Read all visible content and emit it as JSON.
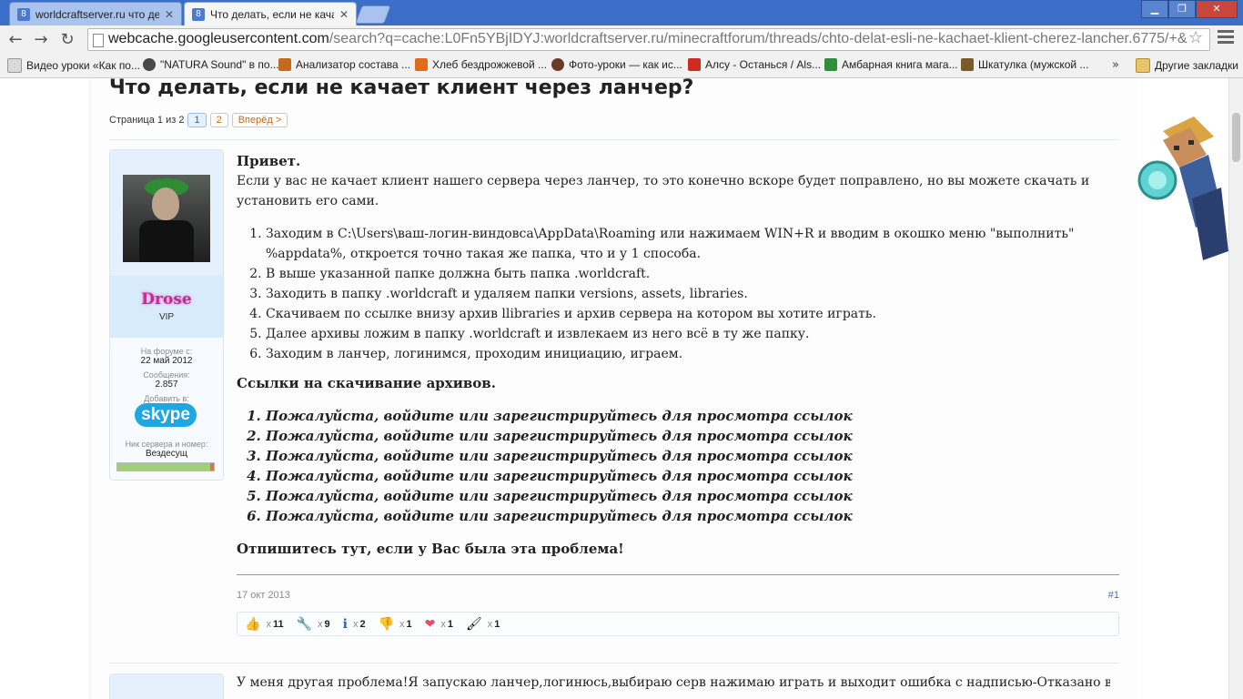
{
  "browser": {
    "tabs": [
      {
        "title": "worldcraftserver.ru что дел",
        "active": false
      },
      {
        "title": "Что делать, если не качае",
        "active": true
      }
    ],
    "window_buttons": {
      "minimize": "▁",
      "maximize": "❐",
      "close": "✕"
    },
    "nav": {
      "back": "←",
      "forward": "→",
      "reload": "↻"
    },
    "address": {
      "host": "webcache.googleusercontent.com",
      "rest": "/search?q=cache:L0Fn5YBjIDYJ:worldcraftserver.ru/minecraftforum/threads/chto-delat-esli-ne-kachaet-klient-cherez-lancher.6775/+&"
    },
    "bookmarks": [
      {
        "label": "Видео уроки «Как по...",
        "color": "#d9d9d9"
      },
      {
        "label": "\"NATURA Sound\" в по...",
        "color": "#4a4a4a"
      },
      {
        "label": "Анализатор состава ...",
        "color": "#c46b1b"
      },
      {
        "label": "Хлеб бездрожжевой ...",
        "color": "#e06a1e"
      },
      {
        "label": "Фото-уроки — как ис...",
        "color": "#6b3b2a"
      },
      {
        "label": "Алсу - Останься / Als...",
        "color": "#d12a21"
      },
      {
        "label": "Амбарная книга мага...",
        "color": "#2f8f3a"
      },
      {
        "label": "Шкатулка (мужской ...",
        "color": "#7a5a2b"
      }
    ],
    "bookmarks_more": "»",
    "other_bookmarks": "Другие закладки"
  },
  "thread": {
    "title": "Что делать, если не качает клиент через ланчер?",
    "page_label": "Страница 1 из 2",
    "pages": [
      "1",
      "2"
    ],
    "next": "Вперёд >"
  },
  "user": {
    "name": "Drose",
    "rank": "VIP",
    "joined_label": "На форуме с:",
    "joined": "22 май 2012",
    "posts_label": "Сообщения:",
    "posts": "2.857",
    "add_label": "Добавить в:",
    "skype": "skype",
    "server_label": "Ник сервера и номер:",
    "server": "Вездесущ"
  },
  "post": {
    "greeting": "Привет.",
    "intro": "Если у вас не качает клиент нашего сервера через ланчер, то это конечно вскоре будет поправлено, но вы можете скачать и установить его сами.",
    "steps": [
      "Заходим в C:\\Users\\ваш-логин-виндовса\\AppData\\Roaming или нажимаем WIN+R и вводим в окошко меню \"выполнить\" %appdata%, откроется точно такая же папка, что и у 1 способа.",
      "В выше указанной папке должна быть папка .worldcraft.",
      "Заходить в папку .worldcraft и удаляем папки versions, assets, libraries.",
      "Скачиваем по ссылке внизу архив llibraries и архив сервера на котором вы хотите играть.",
      "Далее архивы ложим в папку .worldcraft и извлекаем из него всё в ту же папку.",
      "Заходим в ланчер, логинимся, проходим инициацию, играем."
    ],
    "links_heading": "Ссылки на скачивание архивов.",
    "links": [
      "Пожалуйста, войдите или зарегистрируйтесь для просмотра ссылок",
      "Пожалуйста, войдите или зарегистрируйтесь для просмотра ссылок",
      "Пожалуйста, войдите или зарегистрируйтесь для просмотра ссылок",
      "Пожалуйста, войдите или зарегистрируйтесь для просмотра ссылок",
      "Пожалуйста, войдите или зарегистрируйтесь для просмотра ссылок",
      "Пожалуйста, войдите или зарегистрируйтесь для просмотра ссылок"
    ],
    "outro": "Отпишитесь тут, если у Вас была эта проблема!",
    "date": "17 окт 2013",
    "number": "#1",
    "ratings": [
      {
        "icon": "thumbs-up-icon",
        "glyph": "👍",
        "x": "x",
        "count": "11"
      },
      {
        "icon": "wrench-icon",
        "glyph": "🔧",
        "x": "x",
        "count": "9"
      },
      {
        "icon": "info-icon",
        "glyph": "ℹ",
        "x": "x",
        "count": "2"
      },
      {
        "icon": "thumbs-down-icon",
        "glyph": "👎",
        "x": "x",
        "count": "1"
      },
      {
        "icon": "heart-icon",
        "glyph": "❤",
        "x": "x",
        "count": "1"
      },
      {
        "icon": "brush-icon",
        "glyph": "🖌",
        "x": "x",
        "count": "1"
      }
    ]
  },
  "post2": {
    "text": "У меня другая проблема!Я запускаю ланчер,логинюсь,выбираю серв нажимаю играть и выходит ошибка с надписью-Отказано в"
  }
}
